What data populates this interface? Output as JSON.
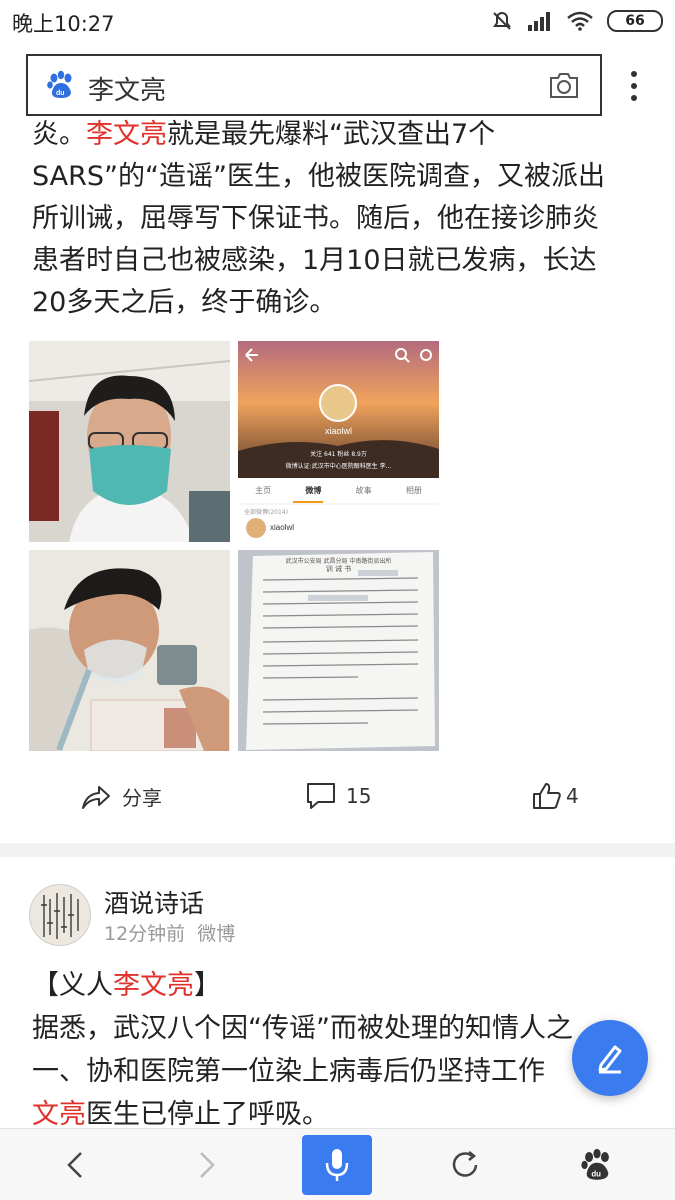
{
  "status_bar": {
    "time": "晚上10:27",
    "battery": "66"
  },
  "search": {
    "query": "李文亮"
  },
  "article": {
    "lines": [
      [
        {
          "t": "炎。"
        },
        {
          "t": "李文亮",
          "hl": true
        },
        {
          "t": "就是最先爆料“武汉查出7个"
        }
      ],
      [
        {
          "t": "SARS”的“造谣”医生，他被医院调查，又被派出"
        }
      ],
      [
        {
          "t": "所训诫，屈辱写下保证书。随后，他在接诊肺炎"
        }
      ],
      [
        {
          "t": "患者时自己也被感染，1月10日就已发病，长达"
        }
      ],
      [
        {
          "t": "20多天之后，终于确诊。"
        }
      ]
    ],
    "weibo_screenshot": {
      "username": "xiaolwl",
      "stats": "关注 641  粉丝 8.9万",
      "verify": "微博认证:武汉市中心医院眼科医生 李...",
      "tabs": [
        "主页",
        "微博",
        "故事",
        "相册"
      ],
      "all_posts": "全部微博(2014)",
      "post_user": "xiaolwl"
    },
    "document_scan": {
      "heading1": "武汉市公安局 武昌分局 中南路街派出所",
      "heading2": "训 诫 书"
    },
    "actions": {
      "share_label": "分享",
      "comment_count": "15",
      "like_count": "4"
    }
  },
  "post": {
    "author": "酒说诗话",
    "time": "12分钟前",
    "source": "微博",
    "lines": [
      [
        {
          "t": "【义人"
        },
        {
          "t": "李文亮",
          "hl": true
        },
        {
          "t": "】"
        }
      ],
      [
        {
          "t": "据悉，武汉八个因“传谣”而被处理的知情人之"
        }
      ],
      [
        {
          "t": "一、协和医院第一位染上病毒后仍坚持工作"
        }
      ],
      [
        {
          "t": "文亮",
          "hl": true
        },
        {
          "t": "医生已停止了呼吸。"
        }
      ]
    ]
  },
  "colors": {
    "accent": "#3a7cf0",
    "highlight": "#e0322b"
  }
}
